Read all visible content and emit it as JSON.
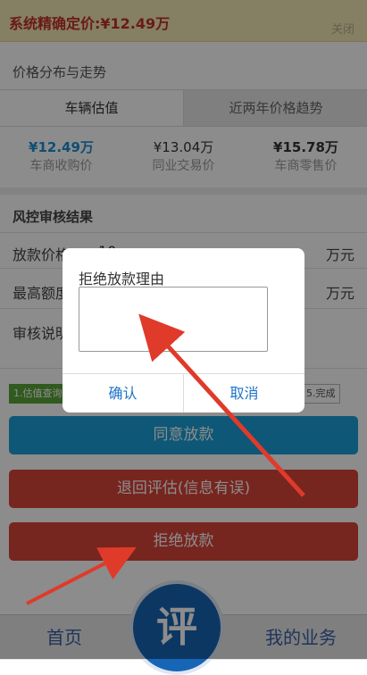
{
  "banner": {
    "label": "系统精确定价:",
    "price": "¥12.49万",
    "close_label": "关闭"
  },
  "section_title": "价格分布与走势",
  "tabs": [
    {
      "label": "车辆估值"
    },
    {
      "label": "近两年价格趋势"
    }
  ],
  "prices": [
    {
      "value": "¥12.49万",
      "label": "车商收购价",
      "color": "#1a8fd6"
    },
    {
      "value": "¥13.04万",
      "label": "同业交易价",
      "color": "#333333"
    },
    {
      "value": "¥15.78万",
      "label": "车商零售价",
      "color": "#333333"
    }
  ],
  "risk": {
    "title": "风控审核结果",
    "rows": [
      {
        "label": "放款价格",
        "value": "10",
        "unit": "万元"
      },
      {
        "label": "最高额度",
        "value": "",
        "unit": "万元"
      },
      {
        "label": "审核说明",
        "value": "",
        "unit": ""
      }
    ]
  },
  "steps": [
    {
      "label": "1.估值查询",
      "active": true
    },
    {
      "label": "5.完成",
      "active": false
    }
  ],
  "buttons": {
    "agree": "同意放款",
    "return": "退回评估(信息有误)",
    "reject": "拒绝放款"
  },
  "nav": {
    "home": "首页",
    "center": "评",
    "mine": "我的业务"
  },
  "dialog": {
    "title": "拒绝放款理由",
    "textarea_value": "",
    "confirm": "确认",
    "cancel": "取消"
  },
  "colors": {
    "accent_blue": "#1a9fd8",
    "danger_red": "#d9443a",
    "nav_blue": "#1765b5",
    "banner_bg": "#f3e8b6"
  }
}
